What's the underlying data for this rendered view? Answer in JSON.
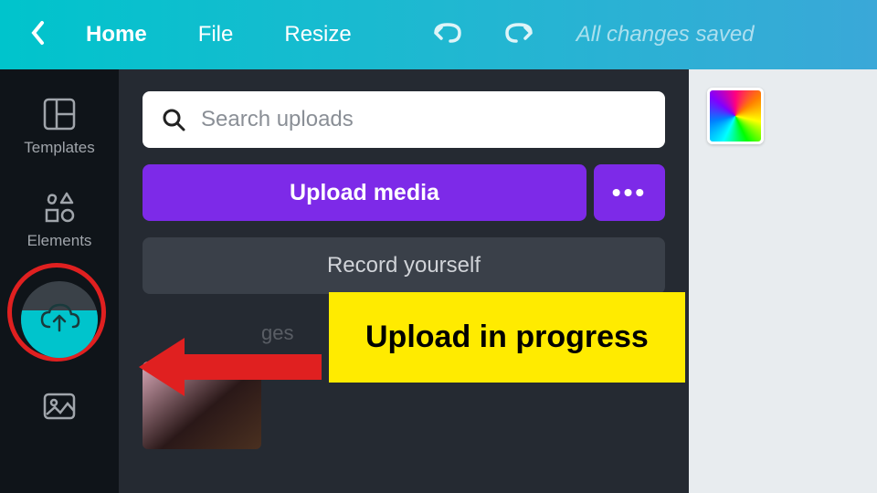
{
  "topbar": {
    "home": "Home",
    "file": "File",
    "resize": "Resize",
    "saved": "All changes saved"
  },
  "sidebar": {
    "templates": "Templates",
    "elements": "Elements"
  },
  "panel": {
    "search_placeholder": "Search uploads",
    "upload_media": "Upload media",
    "more": "•••",
    "record": "Record yourself",
    "tab_fragment": "ges"
  },
  "annotation": {
    "text": "Upload in progress"
  }
}
